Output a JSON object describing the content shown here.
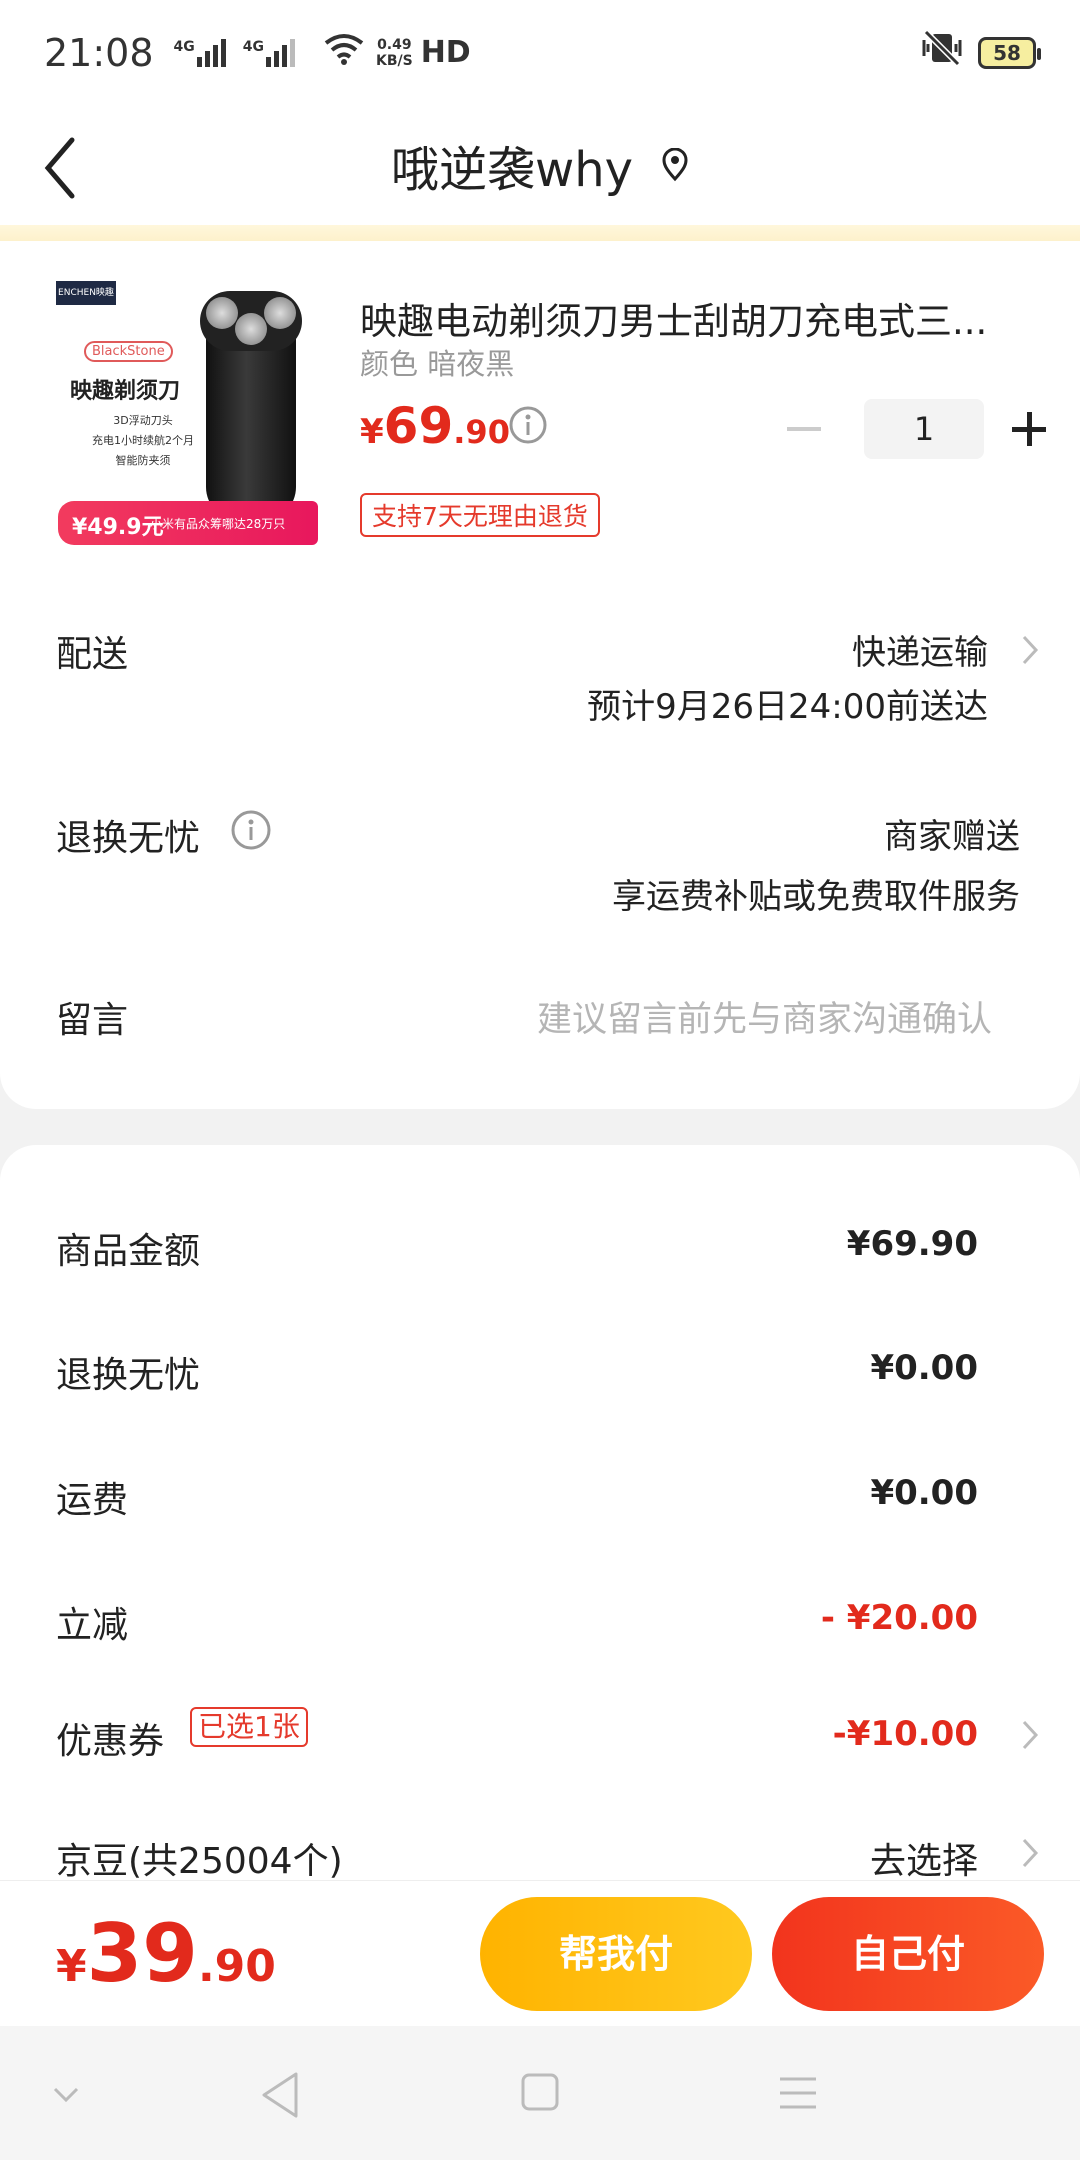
{
  "status_bar": {
    "time": "21:08",
    "signal1_label": "4G",
    "signal2_label": "4G",
    "net_speed": "0.49",
    "net_unit": "KB/S",
    "hd": "HD",
    "battery": "58"
  },
  "header": {
    "title": "哦逆袭why"
  },
  "product": {
    "title": "映趣电动剃须刀男士刮胡刀充电式三...",
    "variant": "颜色 暗夜黑",
    "price_currency": "¥",
    "price_int": "69",
    "price_dec": ".90",
    "quantity": "1",
    "return_badge": "支持7天无理由退货",
    "image": {
      "brand": "ENCHEN映趣",
      "tag": "BlackStone",
      "name": "映趣剃须刀",
      "lines": [
        "3D浮动刀头",
        "充电1小时续航2个月",
        "智能防夹须"
      ],
      "price_bar": "¥49.9元",
      "price_bar_note": "小米有品众筹哪达28万只"
    }
  },
  "delivery": {
    "label": "配送",
    "method": "快递运输",
    "eta": "预计9月26日24:00前送达"
  },
  "return_worry": {
    "label": "退换无忧",
    "gift": "商家赠送",
    "desc": "享运费补贴或免费取件服务"
  },
  "message": {
    "label": "留言",
    "placeholder": "建议留言前先与商家沟通确认"
  },
  "summary": {
    "goods_label": "商品金额",
    "goods_value": "¥69.90",
    "return_label": "退换无忧",
    "return_value": "¥0.00",
    "freight_label": "运费",
    "freight_value": "¥0.00",
    "discount_label": "立减",
    "discount_value": "- ¥20.00",
    "coupon_label": "优惠券",
    "coupon_badge": "已选1张",
    "coupon_value": "-¥10.00",
    "jingdou_label": "京豆(共25004个)",
    "jingdou_action": "去选择"
  },
  "footer": {
    "total_currency": "¥",
    "total_int": "39",
    "total_dec": ".90",
    "help_pay": "帮我付",
    "self_pay": "自己付"
  },
  "colors": {
    "accent_red": "#e22a1c",
    "help_btn": "#ffb300",
    "self_btn": "#f2341d"
  }
}
